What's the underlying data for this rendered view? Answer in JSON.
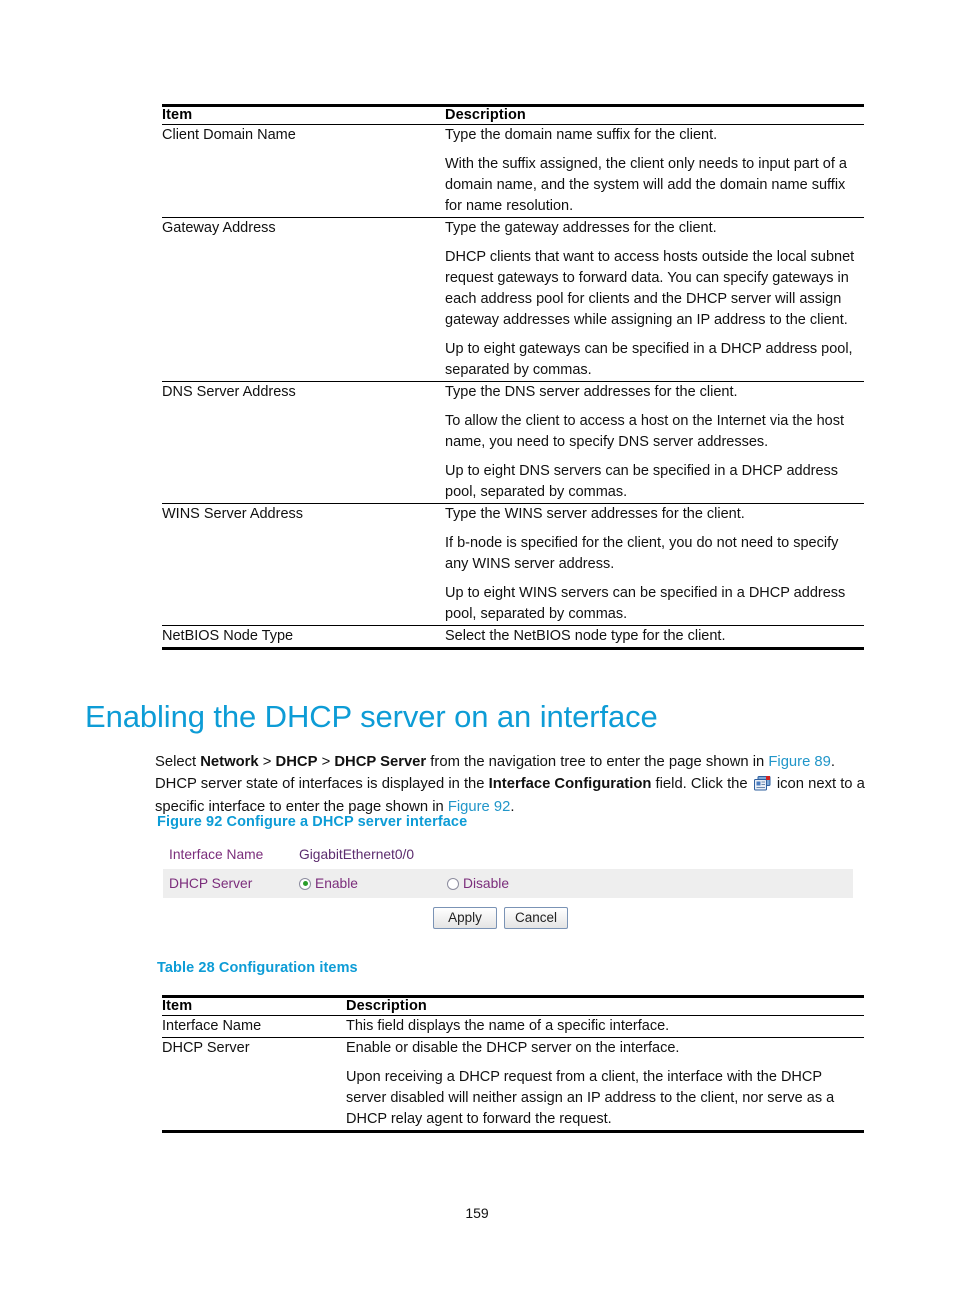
{
  "page": {
    "number": "159"
  },
  "table27": {
    "headers": {
      "item": "Item",
      "description": "Description"
    },
    "rows": [
      {
        "item": "Client Domain Name",
        "paragraphs": [
          "Type the domain name suffix for the client.",
          "With the suffix assigned, the client only needs to input part of a domain name, and the system will add the domain name suffix for name resolution."
        ]
      },
      {
        "item": "Gateway Address",
        "paragraphs": [
          "Type the gateway addresses for the client.",
          "DHCP clients that want to access hosts outside the local subnet request gateways to forward data. You can specify gateways in each address pool for clients and the DHCP server will assign gateway addresses while assigning an IP address to the client.",
          "Up to eight gateways can be specified in a DHCP address pool, separated by commas."
        ]
      },
      {
        "item": "DNS Server Address",
        "paragraphs": [
          "Type the DNS server addresses for the client.",
          "To allow the client to access a host on the Internet via the host name, you need to specify DNS server addresses.",
          "Up to eight DNS servers can be specified in a DHCP address pool, separated by commas."
        ]
      },
      {
        "item": "WINS Server Address",
        "paragraphs": [
          "Type the WINS server addresses for the client.",
          "If b-node is specified for the client, you do not need to specify any WINS server address.",
          "Up to eight WINS servers can be specified in a DHCP address pool, separated by commas."
        ]
      },
      {
        "item": "NetBIOS Node Type",
        "paragraphs": [
          "Select the NetBIOS node type for the client."
        ]
      }
    ]
  },
  "heading": {
    "title": "Enabling the DHCP server on an interface"
  },
  "paragraph": {
    "seg1": "Select ",
    "nav1": "Network",
    "sep1": " > ",
    "nav2": "DHCP",
    "sep2": " > ",
    "nav3": "DHCP Server",
    "seg2": " from the navigation tree to enter the page shown in ",
    "xref1": "Figure 89",
    "seg3": ". DHCP server state of interfaces is displayed in the ",
    "bold1": "Interface Configuration",
    "seg4": " field. Click the ",
    "seg5": " icon next to a specific interface to enter the page shown in ",
    "xref2": "Figure 92",
    "seg6": "."
  },
  "figure": {
    "caption": "Figure 92 Configure a DHCP server interface",
    "ui": {
      "interface_name_label": "Interface Name",
      "interface_name_value": "GigabitEthernet0/0",
      "dhcp_server_label": "DHCP Server",
      "enable_label": "Enable",
      "disable_label": "Disable",
      "selected": "Enable",
      "apply_label": "Apply",
      "cancel_label": "Cancel"
    }
  },
  "table28": {
    "caption": "Table 28 Configuration items",
    "headers": {
      "item": "Item",
      "description": "Description"
    },
    "rows": [
      {
        "item": "Interface Name",
        "paragraphs": [
          "This field displays the name of a specific interface."
        ]
      },
      {
        "item": "DHCP Server",
        "paragraphs": [
          "Enable or disable the DHCP server on the interface.",
          "Upon receiving a DHCP request from a client, the interface with the DHCP server disabled will neither assign an IP address to the client, nor serve as a DHCP relay agent to forward the request."
        ]
      }
    ]
  },
  "colors": {
    "heading_blue": "#0d9cd6",
    "xref_blue": "#2196c9",
    "ui_label_purple": "#7b2d7b",
    "radio_green": "#2a9d2a"
  }
}
